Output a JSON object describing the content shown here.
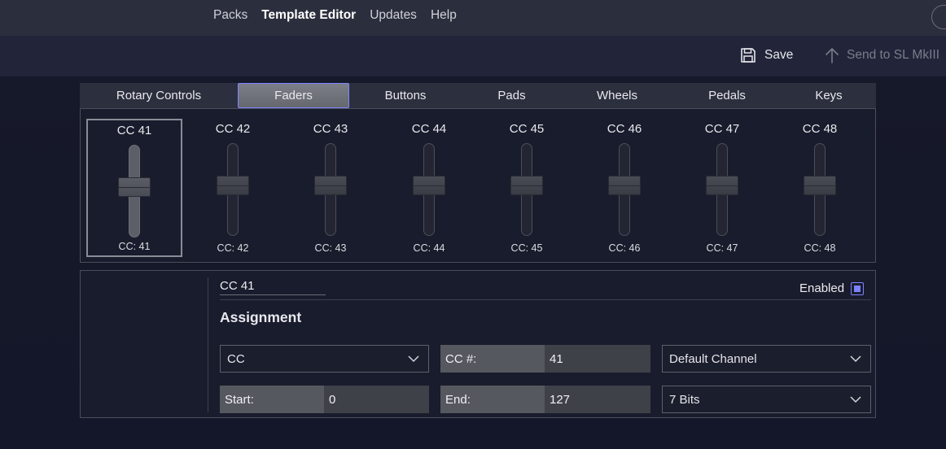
{
  "topnav": {
    "items": [
      "Packs",
      "Template Editor",
      "Updates",
      "Help"
    ],
    "active": "Template Editor"
  },
  "toolbar": {
    "save_label": "Save",
    "send_label": "Send to SL MkIII"
  },
  "tabs": [
    "Rotary Controls",
    "Faders",
    "Buttons",
    "Pads",
    "Wheels",
    "Pedals",
    "Keys"
  ],
  "active_tab": "Faders",
  "faders": [
    {
      "title": "CC 41",
      "label": "CC: 41"
    },
    {
      "title": "CC 42",
      "label": "CC: 42"
    },
    {
      "title": "CC 43",
      "label": "CC: 43"
    },
    {
      "title": "CC 44",
      "label": "CC: 44"
    },
    {
      "title": "CC 45",
      "label": "CC: 45"
    },
    {
      "title": "CC 46",
      "label": "CC: 46"
    },
    {
      "title": "CC 47",
      "label": "CC: 47"
    },
    {
      "title": "CC 48",
      "label": "CC: 48"
    }
  ],
  "detail": {
    "name": "CC 41",
    "enabled_label": "Enabled",
    "enabled": true,
    "assignment_title": "Assignment",
    "message_type": "CC",
    "cc_number_label": "CC #:",
    "cc_number_value": "41",
    "channel": "Default Channel",
    "start_label": "Start:",
    "start_value": "0",
    "end_label": "End:",
    "end_value": "127",
    "bits": "7 Bits"
  },
  "colors": {
    "accent": "#7b82ff",
    "background": "#161a2b",
    "topbar": "#2b2e3d"
  }
}
